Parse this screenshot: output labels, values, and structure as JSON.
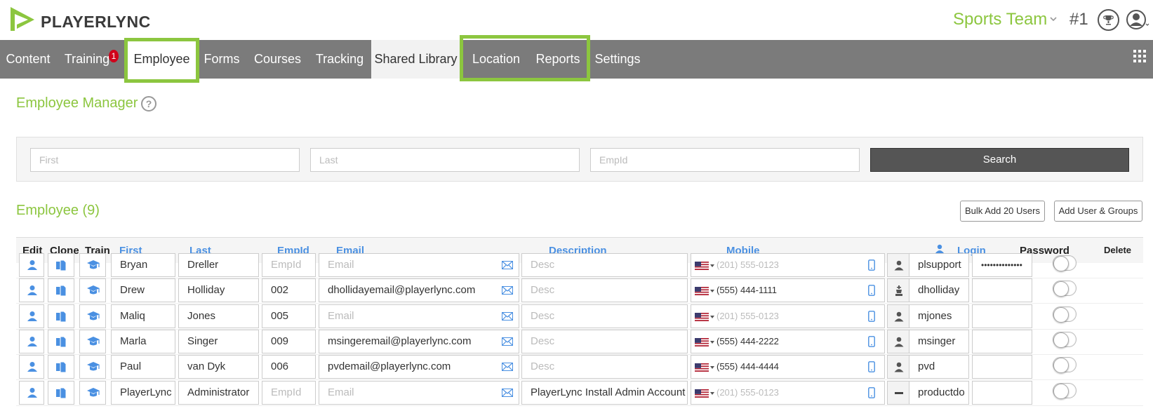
{
  "header": {
    "logo_text": "PLAYERLYNC",
    "team_name": "Sports Team",
    "rank": "#1"
  },
  "nav": {
    "items": [
      {
        "label": "Content"
      },
      {
        "label": "Training",
        "badge": "1"
      },
      {
        "label": "Employee"
      },
      {
        "label": "Forms"
      },
      {
        "label": "Courses"
      },
      {
        "label": "Tracking"
      },
      {
        "label": "Shared Library"
      },
      {
        "label": "Location"
      },
      {
        "label": "Reports"
      },
      {
        "label": "Settings"
      }
    ]
  },
  "page": {
    "title": "Employee Manager",
    "help": "?"
  },
  "search": {
    "first_placeholder": "First",
    "last_placeholder": "Last",
    "empid_placeholder": "EmpId",
    "button": "Search"
  },
  "employees": {
    "title": "Employee (9)",
    "bulk_add_button": "Bulk Add 20 Users",
    "add_user_groups_button": "Add User & Groups",
    "columns": {
      "edit": "Edit",
      "clone": "Clone",
      "train": "Train",
      "first": "First",
      "last": "Last",
      "empid": "EmpId",
      "email": "Email",
      "description": "Description",
      "mobile": "Mobile",
      "login": "Login",
      "password": "Password",
      "delete": "Delete"
    },
    "placeholders": {
      "empid": "EmpId",
      "email": "Email",
      "desc": "Desc",
      "phone": "(201) 555-0123"
    },
    "rows": [
      {
        "first": "Bryan",
        "last": "Dreller",
        "empid": "",
        "email": "",
        "description": "",
        "mobile": "",
        "login": "plsupport",
        "password": "••••••••••••••",
        "role": "person-icon"
      },
      {
        "first": "Drew",
        "last": "Holliday",
        "empid": "002",
        "email": "dhollidayemail@playerlync.com",
        "description": "",
        "mobile": "(555) 444-1111",
        "login": "dholliday",
        "password": "",
        "role": "chess-king-icon"
      },
      {
        "first": "Maliq",
        "last": "Jones",
        "empid": "005",
        "email": "",
        "description": "",
        "mobile": "",
        "login": "mjones",
        "password": "",
        "role": "person-icon"
      },
      {
        "first": "Marla",
        "last": "Singer",
        "empid": "009",
        "email": "msingeremail@playerlync.com",
        "description": "",
        "mobile": "(555) 444-2222",
        "login": "msinger",
        "password": "",
        "role": "person-icon"
      },
      {
        "first": "Paul",
        "last": "van Dyk",
        "empid": "006",
        "email": "pvdemail@playerlync.com",
        "description": "",
        "mobile": "(555) 444-4444",
        "login": "pvd",
        "password": "",
        "role": "person-icon"
      },
      {
        "first": "PlayerLync",
        "last": "Administrator",
        "empid": "",
        "email": "",
        "description": "PlayerLync Install Admin Account",
        "mobile": "",
        "login": "productdo",
        "password": "",
        "role": "minus-icon"
      }
    ]
  },
  "colors": {
    "brand_green": "#8cc63f",
    "nav_gray": "#7b7b7b",
    "link_blue": "#4a90e2",
    "badge_red": "#d0021b"
  }
}
